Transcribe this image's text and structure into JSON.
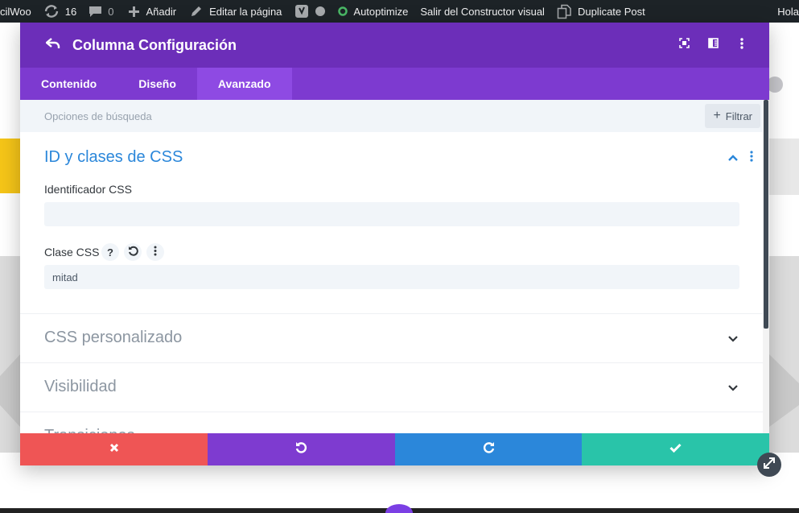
{
  "admin_bar": {
    "site_name": "cilWoo",
    "updates_count": "16",
    "comments_count": "0",
    "new_label": "Añadir",
    "edit_label": "Editar la página",
    "autoptimize_label": "Autoptimize",
    "exit_builder_label": "Salir del Constructor visual",
    "duplicate_label": "Duplicate Post",
    "greeting": "Hola",
    "autoptimize_status_color": "#4ab866"
  },
  "modal": {
    "title": "Columna Configuración",
    "tabs": [
      {
        "label": "Contenido",
        "active": false
      },
      {
        "label": "Diseño",
        "active": false
      },
      {
        "label": "Avanzado",
        "active": true
      }
    ],
    "search_placeholder": "Opciones de búsqueda",
    "filter_label": "Filtrar",
    "sections": {
      "css_id_classes": {
        "title": "ID y clases de CSS",
        "expanded": true,
        "css_id_label": "Identificador CSS",
        "css_id_value": "",
        "css_class_label": "Clase CSS",
        "css_class_value": "mitad",
        "help_glyph": "?"
      },
      "custom_css": {
        "title": "CSS personalizado",
        "expanded": false
      },
      "visibility": {
        "title": "Visibilidad",
        "expanded": false
      },
      "transitions": {
        "title": "Transiciones",
        "expanded": false
      }
    }
  },
  "colors": {
    "header": "#6c2eb9",
    "tabs": "#7d3ad0",
    "accent_blue": "#2b87da",
    "cancel": "#ef5555",
    "undo": "#7e3bd0",
    "redo": "#2b87da",
    "save": "#29c4a9"
  }
}
